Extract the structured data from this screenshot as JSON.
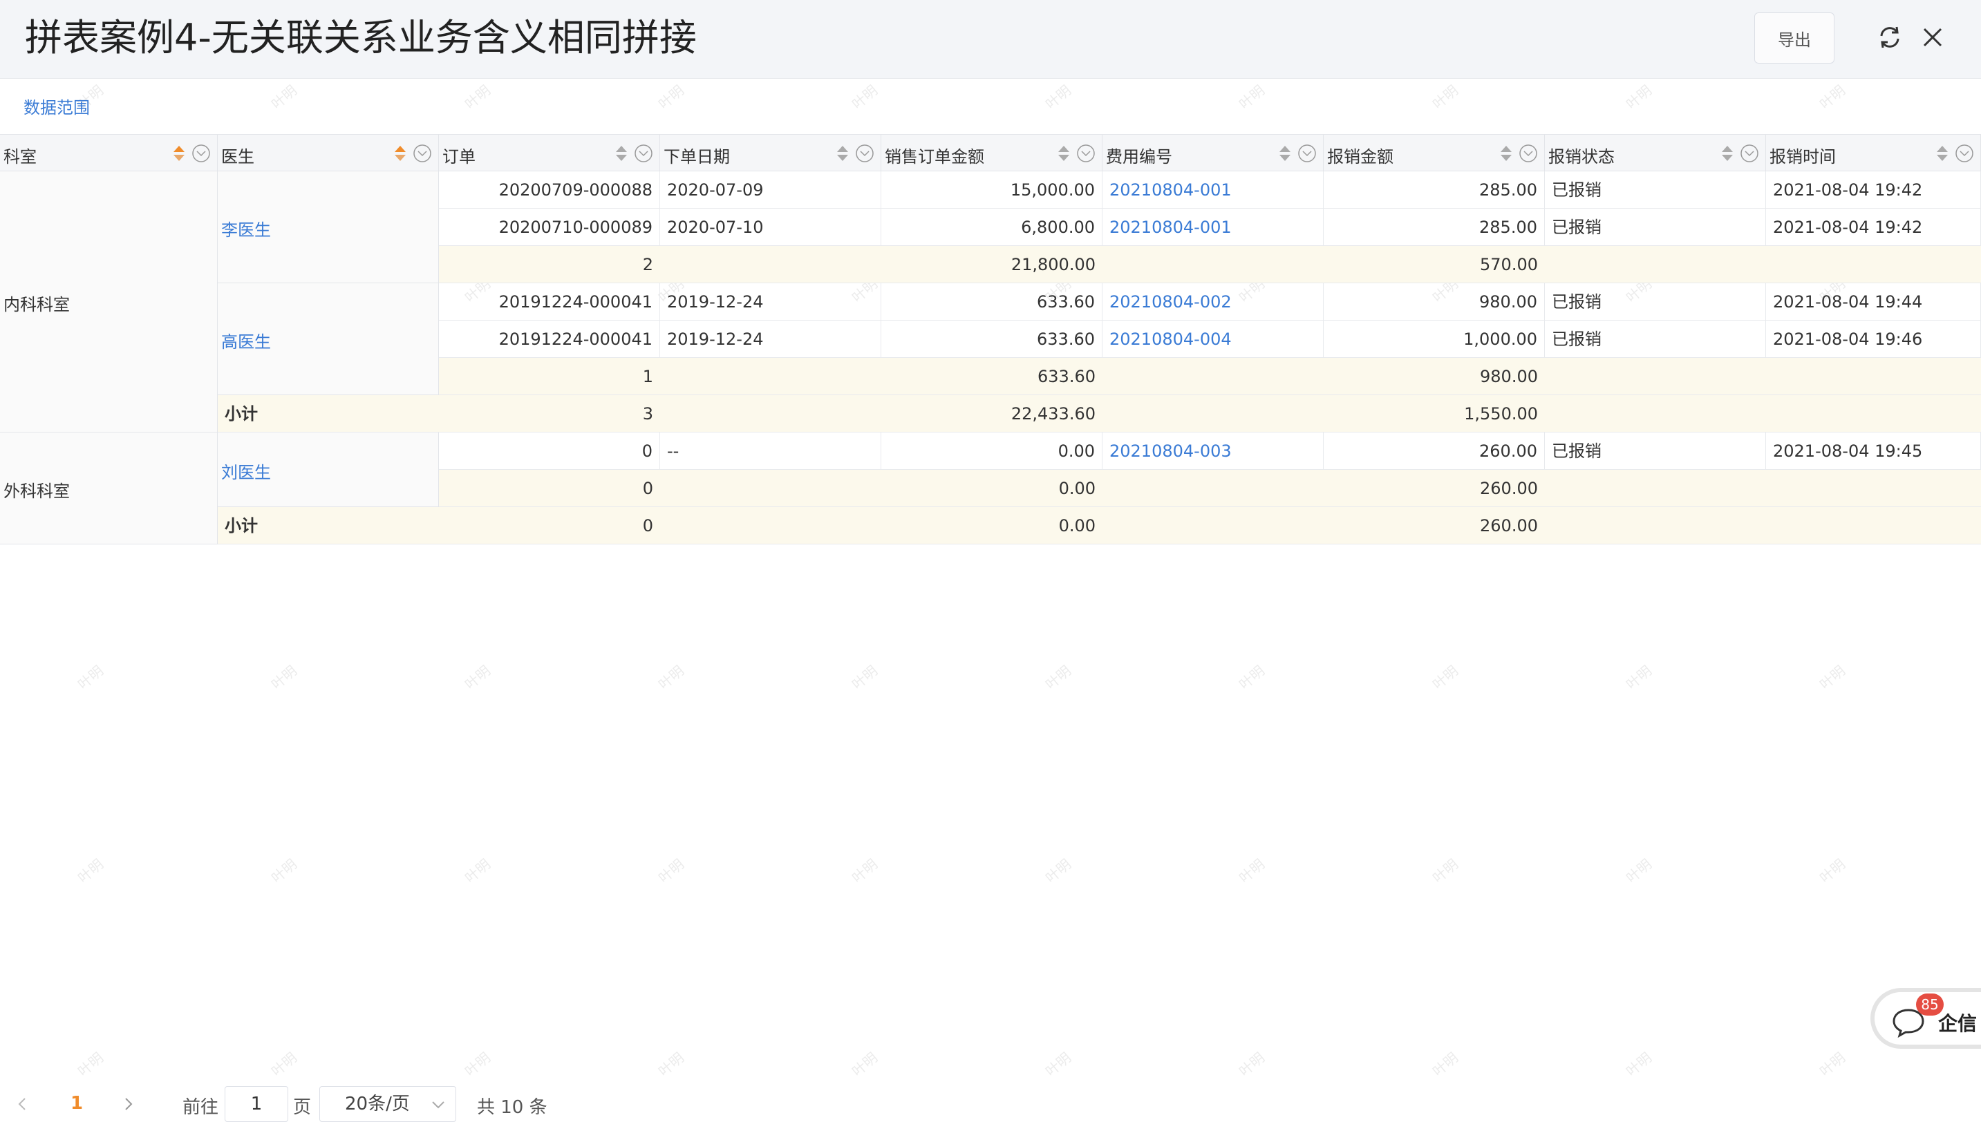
{
  "header": {
    "title": "拼表案例4-无关联关系业务含义相同拼接",
    "export_label": "导出"
  },
  "filter": {
    "data_range_label": "数据范围"
  },
  "columns": [
    "科室",
    "医生",
    "订单",
    "下单日期",
    "销售订单金额",
    "费用编号",
    "报销金额",
    "报销状态",
    "报销时间"
  ],
  "departments": [
    {
      "name": "内科科室",
      "subtotal_label": "小计",
      "subtotal": {
        "orders": "3",
        "amount": "22,433.60",
        "reimb": "1,550.00"
      }
    },
    {
      "name": "外科科室",
      "subtotal_label": "小计",
      "subtotal": {
        "orders": "0",
        "amount": "0.00",
        "reimb": "260.00"
      }
    }
  ],
  "doctors": [
    {
      "name": "李医生",
      "summary": {
        "orders": "2",
        "amount": "21,800.00",
        "reimb": "570.00"
      }
    },
    {
      "name": "高医生",
      "summary": {
        "orders": "1",
        "amount": "633.60",
        "reimb": "980.00"
      }
    },
    {
      "name": "刘医生",
      "summary": {
        "orders": "0",
        "amount": "0.00",
        "reimb": "260.00"
      }
    }
  ],
  "rows": [
    {
      "order": "20200709-000088",
      "date": "2020-07-09",
      "amount": "15,000.00",
      "fee_no": "20210804-001",
      "reimb": "285.00",
      "status": "已报销",
      "time": "2021-08-04 19:42"
    },
    {
      "order": "20200710-000089",
      "date": "2020-07-10",
      "amount": "6,800.00",
      "fee_no": "20210804-001",
      "reimb": "285.00",
      "status": "已报销",
      "time": "2021-08-04 19:42"
    },
    {
      "order": "20191224-000041",
      "date": "2019-12-24",
      "amount": "633.60",
      "fee_no": "20210804-002",
      "reimb": "980.00",
      "status": "已报销",
      "time": "2021-08-04 19:44"
    },
    {
      "order": "20191224-000041",
      "date": "2019-12-24",
      "amount": "633.60",
      "fee_no": "20210804-004",
      "reimb": "1,000.00",
      "status": "已报销",
      "time": "2021-08-04 19:46"
    },
    {
      "order": "0",
      "date": "--",
      "amount": "0.00",
      "fee_no": "20210804-003",
      "reimb": "260.00",
      "status": "已报销",
      "time": "2021-08-04 19:45"
    }
  ],
  "pagination": {
    "current_page": "1",
    "goto_label": "前往",
    "page_input_value": "1",
    "page_unit": "页",
    "page_size": "20条/页",
    "total": "共 10 条"
  },
  "chat": {
    "badge": "85",
    "label": "企信"
  },
  "watermark": "叶明",
  "colors": {
    "link": "#3a7bd5",
    "sort_active": "#f08c2b",
    "summary_bg": "#fcf9ec",
    "badge": "#e54d42",
    "page_active": "#f08c2b"
  }
}
